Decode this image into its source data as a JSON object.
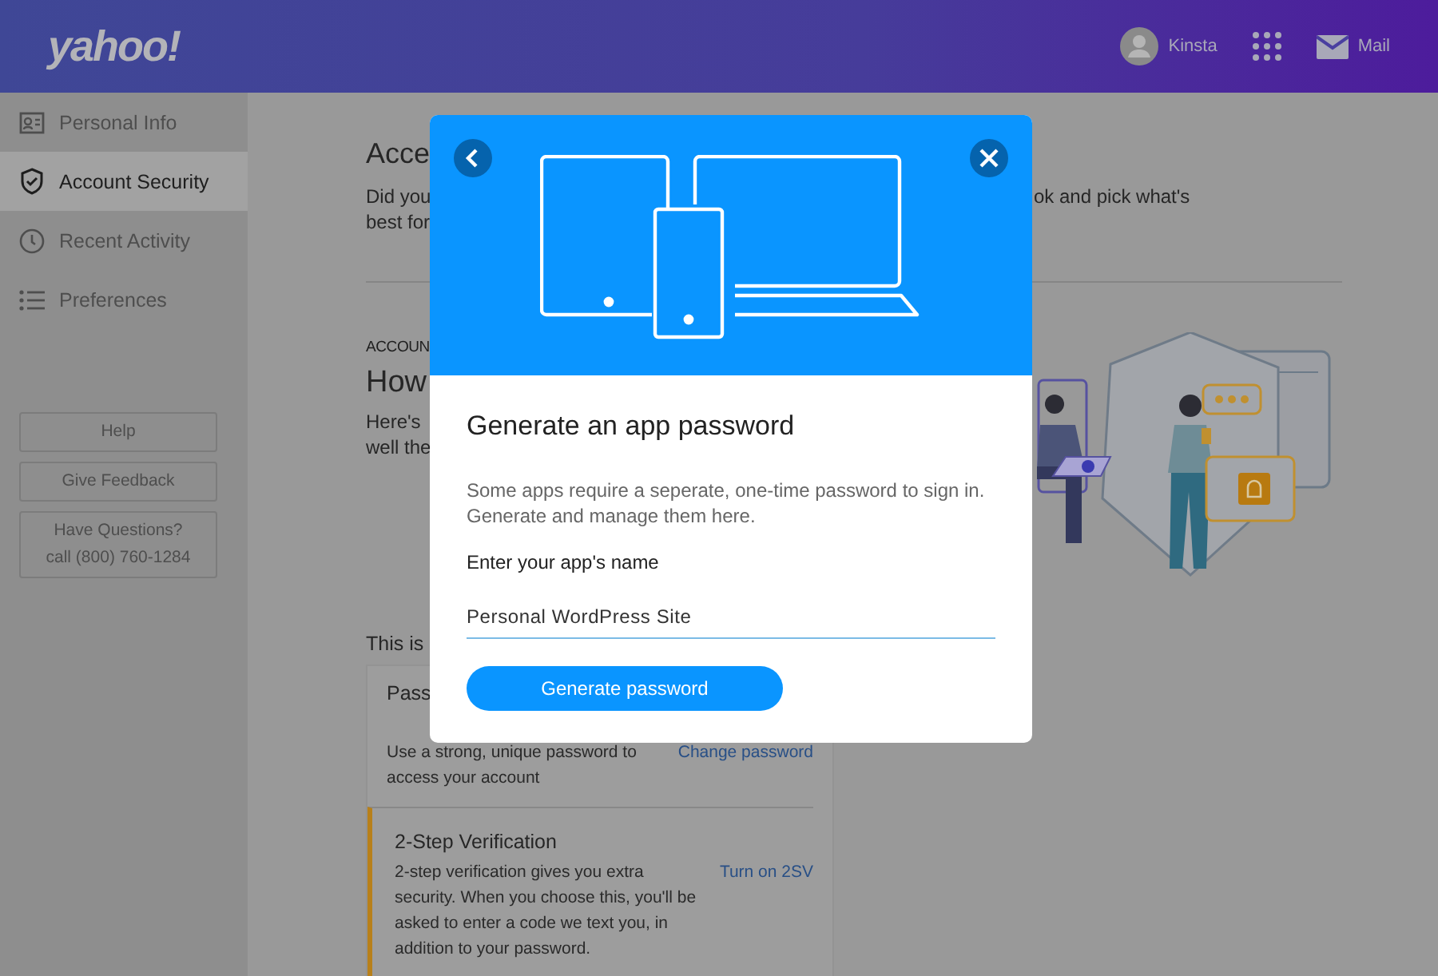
{
  "header": {
    "logo": "yahoo!",
    "user": "Kinsta",
    "mail": "Mail"
  },
  "sidebar": {
    "items": [
      {
        "label": "Personal Info",
        "selected": false
      },
      {
        "label": "Account Security",
        "selected": true
      },
      {
        "label": "Recent Activity",
        "selected": false
      },
      {
        "label": "Preferences",
        "selected": false
      }
    ],
    "buttons": [
      {
        "lines": [
          "Help"
        ]
      },
      {
        "lines": [
          "Give Feedback"
        ]
      },
      {
        "lines": [
          "Have Questions?",
          "call (800) 760-1284"
        ]
      }
    ]
  },
  "page": {
    "title": "Acce",
    "intro": [
      "Did you",
      "best for"
    ],
    "intro_right": "ok and pick what's",
    "section_label": "ACCOUN",
    "section_title": "How",
    "section_text": [
      "Here's",
      "well the"
    ],
    "list_intro": "This is",
    "methods": [
      {
        "title": "Pass",
        "text": "Use a strong, unique password to access your account",
        "link": "Change password",
        "highlighted": false
      },
      {
        "title": "2-Step Verification",
        "text": "2-step verification gives you extra security. When you choose this, you'll be asked to enter a code we text you, in addition to your password.",
        "link": "Turn on 2SV",
        "highlighted": true
      }
    ]
  },
  "dialog": {
    "title": "Generate an app password",
    "description": [
      "Some apps require a seperate, one-time password to sign in.",
      "Generate and manage them here."
    ],
    "field_label": "Enter your app's name",
    "field_value": "Personal WordPress Site",
    "button": "Generate password"
  }
}
